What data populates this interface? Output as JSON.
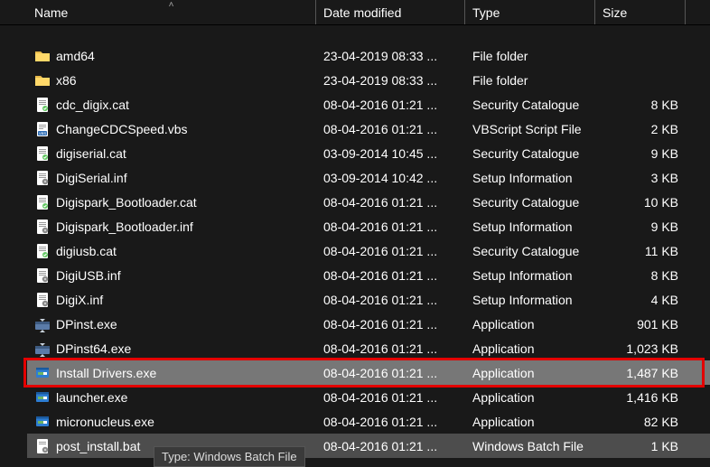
{
  "columns": {
    "name": "Name",
    "date": "Date modified",
    "type": "Type",
    "size": "Size"
  },
  "tooltip_label": "Type: Windows Batch File",
  "rows": [
    {
      "icon": "folder",
      "name": "amd64",
      "date": "23-04-2019 08:33 ...",
      "type": "File folder",
      "size": "",
      "state": ""
    },
    {
      "icon": "folder",
      "name": "x86",
      "date": "23-04-2019 08:33 ...",
      "type": "File folder",
      "size": "",
      "state": ""
    },
    {
      "icon": "cat",
      "name": "cdc_digix.cat",
      "date": "08-04-2016 01:21 ...",
      "type": "Security Catalogue",
      "size": "8 KB",
      "state": ""
    },
    {
      "icon": "vbs",
      "name": "ChangeCDCSpeed.vbs",
      "date": "08-04-2016 01:21 ...",
      "type": "VBScript Script File",
      "size": "2 KB",
      "state": ""
    },
    {
      "icon": "cat",
      "name": "digiserial.cat",
      "date": "03-09-2014 10:45 ...",
      "type": "Security Catalogue",
      "size": "9 KB",
      "state": ""
    },
    {
      "icon": "inf",
      "name": "DigiSerial.inf",
      "date": "03-09-2014 10:42 ...",
      "type": "Setup Information",
      "size": "3 KB",
      "state": ""
    },
    {
      "icon": "cat",
      "name": "Digispark_Bootloader.cat",
      "date": "08-04-2016 01:21 ...",
      "type": "Security Catalogue",
      "size": "10 KB",
      "state": ""
    },
    {
      "icon": "inf",
      "name": "Digispark_Bootloader.inf",
      "date": "08-04-2016 01:21 ...",
      "type": "Setup Information",
      "size": "9 KB",
      "state": ""
    },
    {
      "icon": "cat",
      "name": "digiusb.cat",
      "date": "08-04-2016 01:21 ...",
      "type": "Security Catalogue",
      "size": "11 KB",
      "state": ""
    },
    {
      "icon": "inf",
      "name": "DigiUSB.inf",
      "date": "08-04-2016 01:21 ...",
      "type": "Setup Information",
      "size": "8 KB",
      "state": ""
    },
    {
      "icon": "inf",
      "name": "DigiX.inf",
      "date": "08-04-2016 01:21 ...",
      "type": "Setup Information",
      "size": "4 KB",
      "state": ""
    },
    {
      "icon": "exe-compress",
      "name": "DPinst.exe",
      "date": "08-04-2016 01:21 ...",
      "type": "Application",
      "size": "901 KB",
      "state": ""
    },
    {
      "icon": "exe-compress",
      "name": "DPinst64.exe",
      "date": "08-04-2016 01:21 ...",
      "type": "Application",
      "size": "1,023 KB",
      "state": ""
    },
    {
      "icon": "exe-install",
      "name": "Install Drivers.exe",
      "date": "08-04-2016 01:21 ...",
      "type": "Application",
      "size": "1,487 KB",
      "state": "selected highlighted"
    },
    {
      "icon": "exe-install",
      "name": "launcher.exe",
      "date": "08-04-2016 01:21 ...",
      "type": "Application",
      "size": "1,416 KB",
      "state": ""
    },
    {
      "icon": "exe-install",
      "name": "micronucleus.exe",
      "date": "08-04-2016 01:21 ...",
      "type": "Application",
      "size": "82 KB",
      "state": ""
    },
    {
      "icon": "bat",
      "name": "post_install.bat",
      "date": "08-04-2016 01:21 ...",
      "type": "Windows Batch File",
      "size": "1 KB",
      "state": "hover"
    }
  ]
}
